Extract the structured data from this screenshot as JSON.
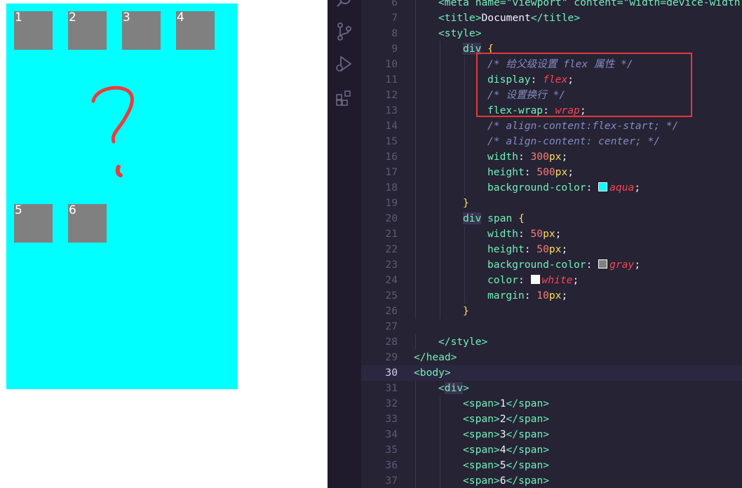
{
  "preview": {
    "background": "#00ffff",
    "box_color": "#808080",
    "boxes": [
      "1",
      "2",
      "3",
      "4",
      "5",
      "6"
    ]
  },
  "editor": {
    "lines": [
      {
        "n": "6",
        "tokens": [
          {
            "t": "<meta name=\"viewport\" content=\"width=device-width",
            "c": "t-tag"
          }
        ],
        "indent": 1
      },
      {
        "n": "7",
        "tokens": [
          {
            "t": "<title>",
            "c": "t-tag"
          },
          {
            "t": "Document",
            "c": "t-text"
          },
          {
            "t": "</title>",
            "c": "t-tag"
          }
        ],
        "indent": 1
      },
      {
        "n": "8",
        "tokens": [
          {
            "t": "<style>",
            "c": "t-tag"
          }
        ],
        "indent": 1
      },
      {
        "n": "9",
        "tokens": [
          {
            "t": "div",
            "c": "t-sel"
          },
          {
            "t": " {",
            "c": "t-brace"
          }
        ],
        "indent": 2
      },
      {
        "n": "10",
        "tokens": [
          {
            "t": "/* 给父级设置 flex 属性 */",
            "c": "t-comment"
          }
        ],
        "indent": 3
      },
      {
        "n": "11",
        "tokens": [
          {
            "t": "display",
            "c": "t-prop"
          },
          {
            "t": ": ",
            "c": "t-punc"
          },
          {
            "t": "flex",
            "c": "t-val"
          },
          {
            "t": ";",
            "c": "t-punc"
          }
        ],
        "indent": 3
      },
      {
        "n": "12",
        "tokens": [
          {
            "t": "/* 设置换行 */",
            "c": "t-comment"
          }
        ],
        "indent": 3
      },
      {
        "n": "13",
        "tokens": [
          {
            "t": "flex-wrap",
            "c": "t-prop"
          },
          {
            "t": ": ",
            "c": "t-punc"
          },
          {
            "t": "wrap",
            "c": "t-val"
          },
          {
            "t": ";",
            "c": "t-punc"
          }
        ],
        "indent": 3
      },
      {
        "n": "14",
        "tokens": [
          {
            "t": "/* align-content:flex-start; */",
            "c": "t-comment"
          }
        ],
        "indent": 3
      },
      {
        "n": "15",
        "tokens": [
          {
            "t": "/* align-content: center; */",
            "c": "t-comment"
          }
        ],
        "indent": 3
      },
      {
        "n": "16",
        "tokens": [
          {
            "t": "width",
            "c": "t-prop"
          },
          {
            "t": ": ",
            "c": "t-punc"
          },
          {
            "t": "300",
            "c": "t-num"
          },
          {
            "t": "px",
            "c": "t-unit"
          },
          {
            "t": ";",
            "c": "t-punc"
          }
        ],
        "indent": 3
      },
      {
        "n": "17",
        "tokens": [
          {
            "t": "height",
            "c": "t-prop"
          },
          {
            "t": ": ",
            "c": "t-punc"
          },
          {
            "t": "500",
            "c": "t-num"
          },
          {
            "t": "px",
            "c": "t-unit"
          },
          {
            "t": ";",
            "c": "t-punc"
          }
        ],
        "indent": 3
      },
      {
        "n": "18",
        "tokens": [
          {
            "t": "background-color",
            "c": "t-prop"
          },
          {
            "t": ": ",
            "c": "t-punc"
          },
          {
            "swatch": "#00ffff"
          },
          {
            "t": "aqua",
            "c": "t-val"
          },
          {
            "t": ";",
            "c": "t-punc"
          }
        ],
        "indent": 3
      },
      {
        "n": "19",
        "tokens": [
          {
            "t": "}",
            "c": "t-brace"
          }
        ],
        "indent": 2
      },
      {
        "n": "20",
        "tokens": [
          {
            "t": "div",
            "c": "t-sel"
          },
          {
            "t": " span",
            "c": "t-prop"
          },
          {
            "t": " {",
            "c": "t-brace"
          }
        ],
        "indent": 2
      },
      {
        "n": "21",
        "tokens": [
          {
            "t": "width",
            "c": "t-prop"
          },
          {
            "t": ": ",
            "c": "t-punc"
          },
          {
            "t": "50",
            "c": "t-num"
          },
          {
            "t": "px",
            "c": "t-unit"
          },
          {
            "t": ";",
            "c": "t-punc"
          }
        ],
        "indent": 3
      },
      {
        "n": "22",
        "tokens": [
          {
            "t": "height",
            "c": "t-prop"
          },
          {
            "t": ": ",
            "c": "t-punc"
          },
          {
            "t": "50",
            "c": "t-num"
          },
          {
            "t": "px",
            "c": "t-unit"
          },
          {
            "t": ";",
            "c": "t-punc"
          }
        ],
        "indent": 3
      },
      {
        "n": "23",
        "tokens": [
          {
            "t": "background-color",
            "c": "t-prop"
          },
          {
            "t": ": ",
            "c": "t-punc"
          },
          {
            "swatch": "#808080"
          },
          {
            "t": "gray",
            "c": "t-val"
          },
          {
            "t": ";",
            "c": "t-punc"
          }
        ],
        "indent": 3
      },
      {
        "n": "24",
        "tokens": [
          {
            "t": "color",
            "c": "t-prop"
          },
          {
            "t": ": ",
            "c": "t-punc"
          },
          {
            "swatch": "#ffffff"
          },
          {
            "t": "white",
            "c": "t-val"
          },
          {
            "t": ";",
            "c": "t-punc"
          }
        ],
        "indent": 3
      },
      {
        "n": "25",
        "tokens": [
          {
            "t": "margin",
            "c": "t-prop"
          },
          {
            "t": ": ",
            "c": "t-punc"
          },
          {
            "t": "10",
            "c": "t-num"
          },
          {
            "t": "px",
            "c": "t-unit"
          },
          {
            "t": ";",
            "c": "t-punc"
          }
        ],
        "indent": 3
      },
      {
        "n": "26",
        "tokens": [
          {
            "t": "}",
            "c": "t-brace"
          }
        ],
        "indent": 2
      },
      {
        "n": "27",
        "tokens": [],
        "indent": 0
      },
      {
        "n": "28",
        "tokens": [
          {
            "t": "</style>",
            "c": "t-tag"
          }
        ],
        "indent": 1
      },
      {
        "n": "29",
        "tokens": [
          {
            "t": "</head>",
            "c": "t-tag"
          }
        ],
        "indent": 0
      },
      {
        "n": "30",
        "tokens": [
          {
            "t": "<body>",
            "c": "t-tag"
          }
        ],
        "indent": 0,
        "current": true
      },
      {
        "n": "31",
        "tokens": [
          {
            "t": "<",
            "c": "t-tag"
          },
          {
            "t": "div",
            "c": "t-sel"
          },
          {
            "t": ">",
            "c": "t-tag"
          }
        ],
        "indent": 1
      },
      {
        "n": "32",
        "tokens": [
          {
            "t": "<span>",
            "c": "t-tag"
          },
          {
            "t": "1",
            "c": "t-text"
          },
          {
            "t": "</span>",
            "c": "t-tag"
          }
        ],
        "indent": 2
      },
      {
        "n": "33",
        "tokens": [
          {
            "t": "<span>",
            "c": "t-tag"
          },
          {
            "t": "2",
            "c": "t-text"
          },
          {
            "t": "</span>",
            "c": "t-tag"
          }
        ],
        "indent": 2
      },
      {
        "n": "34",
        "tokens": [
          {
            "t": "<span>",
            "c": "t-tag"
          },
          {
            "t": "3",
            "c": "t-text"
          },
          {
            "t": "</span>",
            "c": "t-tag"
          }
        ],
        "indent": 2
      },
      {
        "n": "35",
        "tokens": [
          {
            "t": "<span>",
            "c": "t-tag"
          },
          {
            "t": "4",
            "c": "t-text"
          },
          {
            "t": "</span>",
            "c": "t-tag"
          }
        ],
        "indent": 2
      },
      {
        "n": "36",
        "tokens": [
          {
            "t": "<span>",
            "c": "t-tag"
          },
          {
            "t": "5",
            "c": "t-text"
          },
          {
            "t": "</span>",
            "c": "t-tag"
          }
        ],
        "indent": 2
      },
      {
        "n": "37",
        "tokens": [
          {
            "t": "<span>",
            "c": "t-tag"
          },
          {
            "t": "6",
            "c": "t-text"
          },
          {
            "t": "</span>",
            "c": "t-tag"
          }
        ],
        "indent": 2
      }
    ]
  },
  "activity_icons": [
    "search-icon",
    "source-control-icon",
    "run-debug-icon",
    "extensions-icon"
  ]
}
